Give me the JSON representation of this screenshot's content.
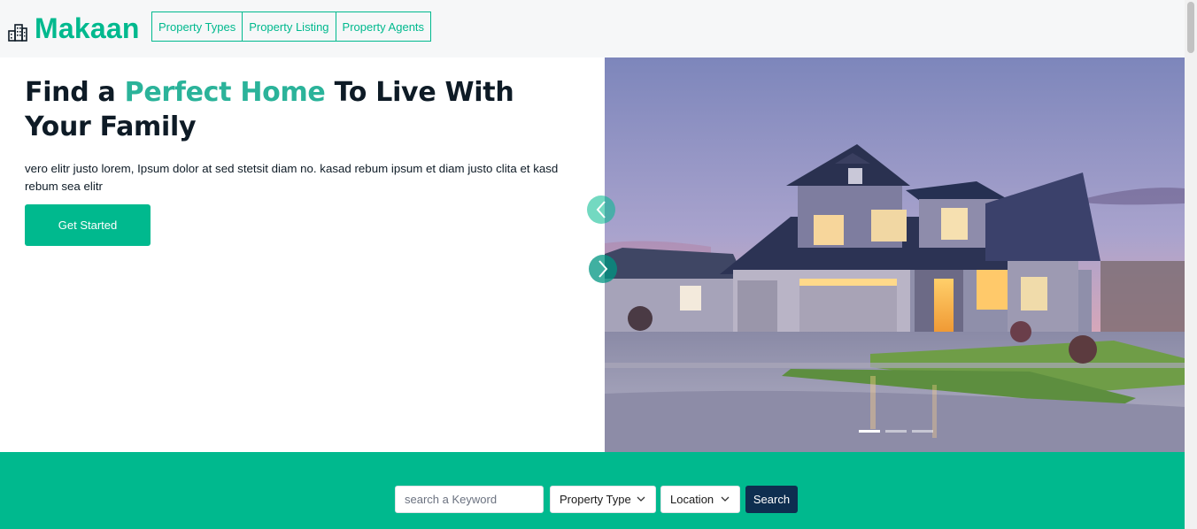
{
  "brand": {
    "name": "Makaan",
    "icon": "building-icon"
  },
  "nav": {
    "items": [
      "Property Types",
      "Property Listing",
      "Property Agents"
    ]
  },
  "hero": {
    "title_start": "Find a ",
    "title_accent": "Perfect Home",
    "title_end": " To Live With Your Family",
    "text": "vero elitr justo lorem, Ipsum dolor at sed stetsit diam no. kasad rebum ipsum et diam justo clita et kasd rebum sea elitr",
    "cta_label": "Get Started",
    "carousel": {
      "slides": 3,
      "active_index": 0,
      "prev_icon": "chevron-left-icon",
      "next_icon": "chevron-right-icon"
    }
  },
  "search": {
    "keyword_placeholder": "search a Keyword",
    "property_type_value": "Property Type",
    "location_value": "Location",
    "button_label": "Search"
  },
  "colors": {
    "accent": "#00b98e",
    "dark": "#0e2e50",
    "text": "#0e1b26"
  }
}
